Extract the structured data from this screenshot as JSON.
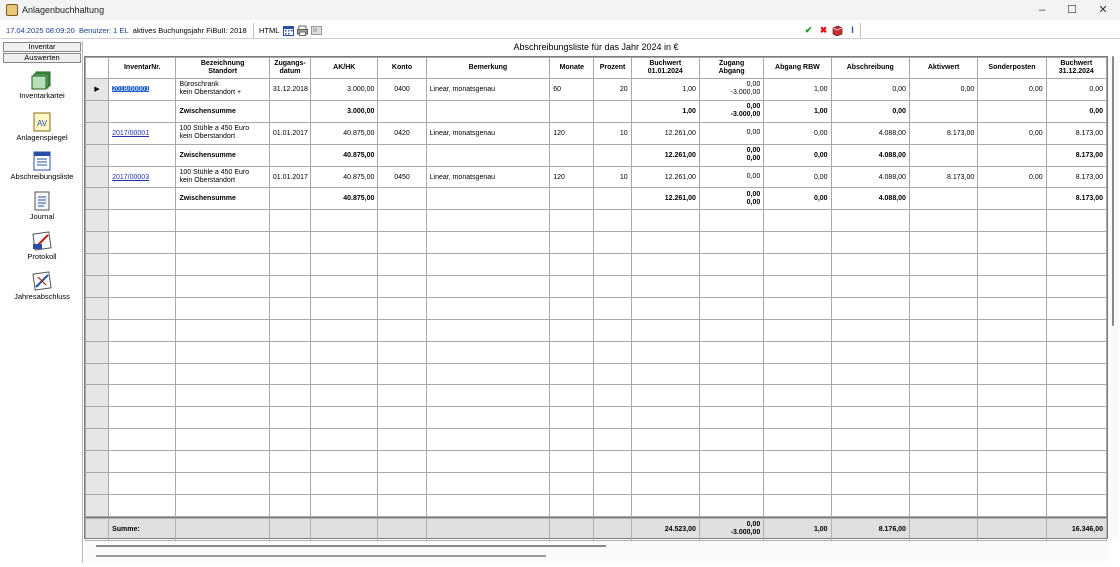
{
  "window": {
    "title": "Anlagenbuchhaltung",
    "controls": [
      "–",
      "☐",
      "✕"
    ]
  },
  "infobar": {
    "date": "17.04.2025 08:09:20",
    "user": "Benutzer: 1  EL",
    "fiscal_year": "aktives Buchungsjahr FiBuII: 2018",
    "html_label": "HTML"
  },
  "sidebar": {
    "tab_inventar": "Inventar",
    "tab_auswerten": "Auswerten",
    "items": [
      {
        "label": "Inventarkartei",
        "icon": "folders-icon"
      },
      {
        "label": "Anlagenspiegel",
        "icon": "mirror-icon"
      },
      {
        "label": "Abschreibungsliste",
        "icon": "list-icon"
      },
      {
        "label": "Journal",
        "icon": "journal-icon"
      },
      {
        "label": "Protokoll",
        "icon": "protocol-icon"
      },
      {
        "label": "Jahresabschluss",
        "icon": "closing-icon"
      }
    ]
  },
  "report": {
    "title": "Abschreibungsliste für das Jahr 2024 in  €",
    "columns": [
      "InventarNr.",
      "Bezeichnung\nStandort",
      "Zugangs-\ndatum",
      "AK/HK",
      "Konto",
      "Bemerkung",
      "Monate",
      "Prozent",
      "Buchwert\n01.01.2024",
      "Zugang\nAbgang",
      "Abgang RBW",
      "Abschreibung",
      "Aktivwert",
      "Sonderposten",
      "Buchwert\n31.12.2024"
    ],
    "rows": [
      {
        "type": "item",
        "marker": "▶",
        "inv": "2018/00001",
        "selected": true,
        "bez1": "Büroschrank",
        "bez2": "kein Oberstandort  +",
        "datum": "31.12.2018",
        "akhk": "3.000,00",
        "konto": "0400",
        "bemerkung": "Linear, monatsgenau",
        "monate": "60",
        "prozent": "20",
        "bw_start": "1,00",
        "zugang": "0,00",
        "abgang": "-3.000,00",
        "abgang_rbw": "1,00",
        "abschreibung": "0,00",
        "aktivwert": "0,00",
        "sonderposten": "0,00",
        "bw_end": "0,00"
      },
      {
        "type": "sum",
        "label": "Zwischensumme",
        "akhk": "3.000,00",
        "bw_start": "1,00",
        "zugang": "0,00",
        "abgang": "-3.000,00",
        "abgang_rbw": "1,00",
        "abschreibung": "0,00",
        "bw_end": "0,00"
      },
      {
        "type": "item",
        "marker": "",
        "inv": "2017/00001",
        "selected": false,
        "bez1": "100 Stühle a 450 Euro",
        "bez2": "kein Oberstandort",
        "datum": "01.01.2017",
        "akhk": "40.875,00",
        "konto": "0420",
        "bemerkung": "Linear, monatsgenau",
        "monate": "120",
        "prozent": "10",
        "bw_start": "12.261,00",
        "zugang": "0,00",
        "abgang": "",
        "abgang_rbw": "0,00",
        "abschreibung": "4.088,00",
        "aktivwert": "8.173,00",
        "sonderposten": "0,00",
        "bw_end": "8.173,00"
      },
      {
        "type": "sum",
        "label": "Zwischensumme",
        "akhk": "40.875,00",
        "bw_start": "12.261,00",
        "zugang": "0,00",
        "abgang": "0,00",
        "abgang_rbw": "0,00",
        "abschreibung": "4.088,00",
        "bw_end": "8.173,00"
      },
      {
        "type": "item",
        "marker": "",
        "inv": "2017/00003",
        "selected": false,
        "bez1": "100 Stühle a 450 Euro",
        "bez2": "kein Oberstandort",
        "datum": "01.01.2017",
        "akhk": "40.875,00",
        "konto": "0450",
        "bemerkung": "Linear, monatsgenau",
        "monate": "120",
        "prozent": "10",
        "bw_start": "12.261,00",
        "zugang": "0,00",
        "abgang": "",
        "abgang_rbw": "0,00",
        "abschreibung": "4.088,00",
        "aktivwert": "8.173,00",
        "sonderposten": "0,00",
        "bw_end": "8.173,00"
      },
      {
        "type": "sum",
        "label": "Zwischensumme",
        "akhk": "40.875,00",
        "bw_start": "12.261,00",
        "zugang": "0,00",
        "abgang": "0,00",
        "abgang_rbw": "0,00",
        "abschreibung": "4.088,00",
        "bw_end": "8.173,00"
      }
    ],
    "summary": {
      "label": "Summe:",
      "bw_start": "24.523,00",
      "zugang": "0,00",
      "abgang": "-3.000,00",
      "abgang_rbw": "1,00",
      "abschreibung": "8.176,00",
      "bw_end": "16.346,00"
    }
  },
  "colors": {
    "link": "#2233aa",
    "selection": "#1f60d0",
    "ok": "#1a9a1a",
    "cancel": "#dd1111"
  }
}
